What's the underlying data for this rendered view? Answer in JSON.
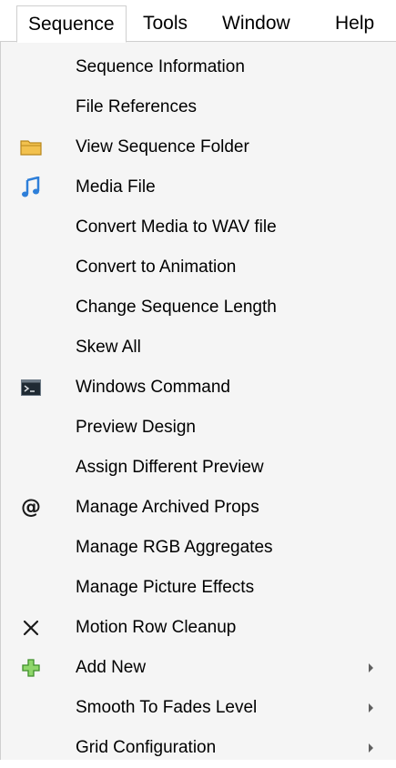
{
  "menubar": {
    "items": [
      {
        "label": "Sequence",
        "active": true
      },
      {
        "label": "Tools",
        "active": false
      },
      {
        "label": "Window",
        "active": false
      },
      {
        "label": "Help",
        "active": false
      }
    ]
  },
  "menu": {
    "items": [
      {
        "label": "Sequence Information",
        "icon": null,
        "submenu": false
      },
      {
        "label": "File References",
        "icon": null,
        "submenu": false
      },
      {
        "label": "View Sequence Folder",
        "icon": "folder-icon",
        "submenu": false
      },
      {
        "label": "Media File",
        "icon": "music-note-icon",
        "submenu": false
      },
      {
        "label": "Convert Media to WAV file",
        "icon": null,
        "submenu": false
      },
      {
        "label": "Convert to Animation",
        "icon": null,
        "submenu": false
      },
      {
        "label": "Change Sequence Length",
        "icon": null,
        "submenu": false
      },
      {
        "label": "Skew All",
        "icon": null,
        "submenu": false
      },
      {
        "label": "Windows Command",
        "icon": "command-prompt-icon",
        "submenu": false
      },
      {
        "label": "Preview Design",
        "icon": null,
        "submenu": false
      },
      {
        "label": "Assign Different Preview",
        "icon": null,
        "submenu": false
      },
      {
        "label": "Manage Archived Props",
        "icon": "at-sign-icon",
        "submenu": false
      },
      {
        "label": "Manage RGB Aggregates",
        "icon": null,
        "submenu": false
      },
      {
        "label": "Manage Picture Effects",
        "icon": null,
        "submenu": false
      },
      {
        "label": "Motion Row Cleanup",
        "icon": "x-mark-icon",
        "submenu": false
      },
      {
        "label": "Add New",
        "icon": "green-plus-icon",
        "submenu": true
      },
      {
        "label": "Smooth To Fades Level",
        "icon": null,
        "submenu": true
      },
      {
        "label": "Grid Configuration",
        "icon": null,
        "submenu": true
      }
    ]
  },
  "icons": {
    "at_glyph": "@"
  },
  "colors": {
    "folder": "#f2c14e",
    "music_note": "#2e7fd9",
    "plus_fill": "#8fd66b",
    "plus_stroke": "#3f8f2a",
    "menu_background": "#f5f5f5"
  }
}
